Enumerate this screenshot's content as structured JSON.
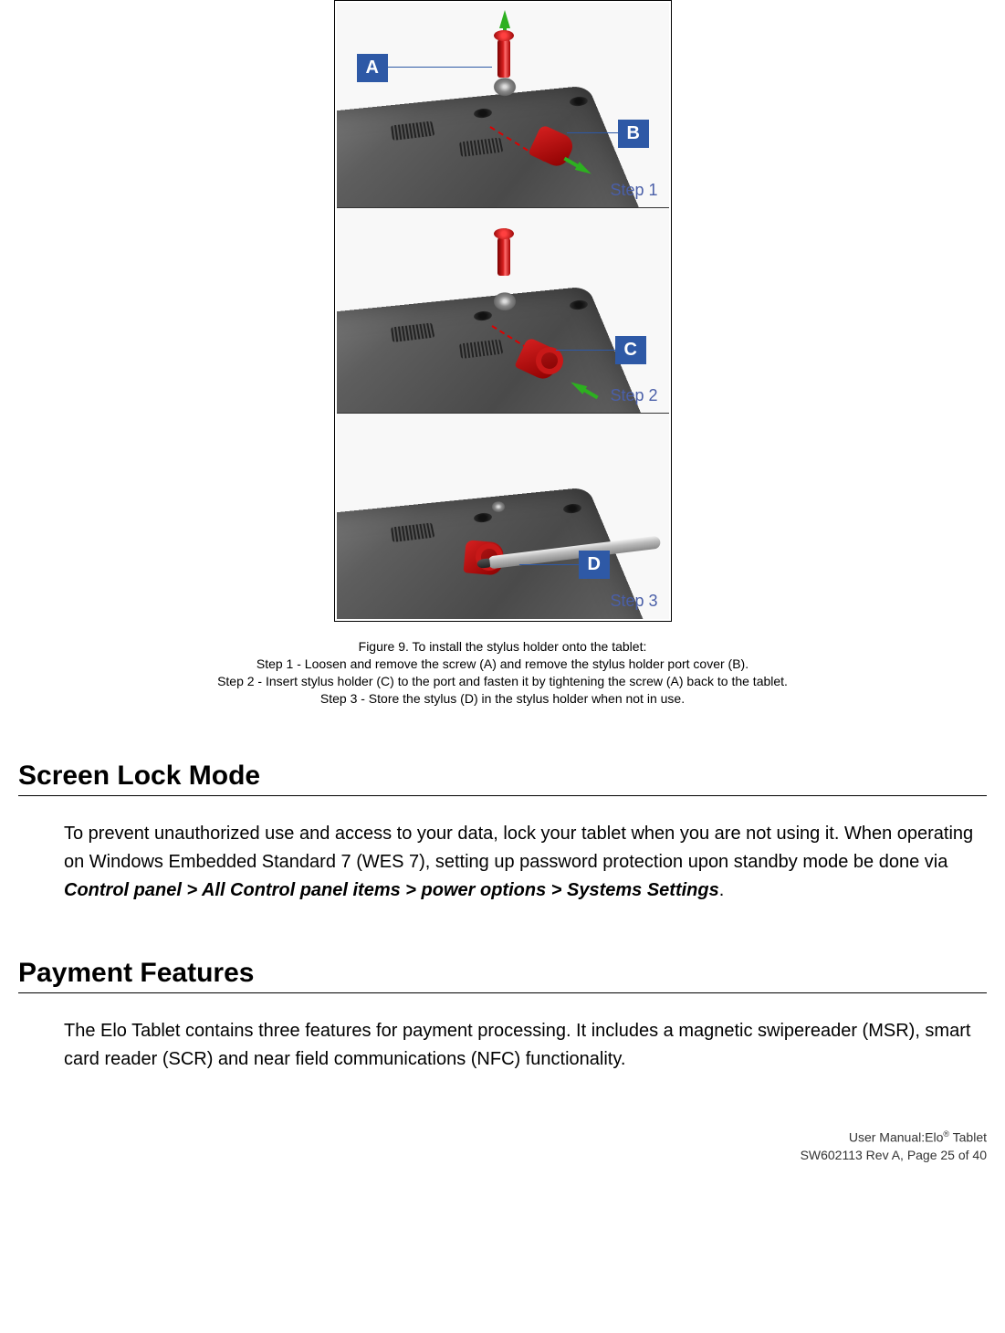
{
  "figure": {
    "labels": {
      "a": "A",
      "b": "B",
      "c": "C",
      "d": "D"
    },
    "steps": {
      "s1": "Step 1",
      "s2": "Step 2",
      "s3": "Step 3"
    },
    "caption_title": "Figure 9. To install the stylus holder onto the tablet:",
    "caption_s1": "Step 1 - Loosen and remove the screw (A) and remove the stylus holder port cover (B).",
    "caption_s2": "Step 2 - Insert stylus holder (C) to the port and fasten it by tightening the screw (A) back to the tablet.",
    "caption_s3": "Step 3 - Store the stylus (D) in the stylus holder when not in use."
  },
  "sections": {
    "screen_lock": {
      "heading": "Screen Lock Mode",
      "para_pre": "To prevent unauthorized use and access to your data, lock your tablet when you are not using it. When operating on Windows Embedded Standard 7 (WES 7), setting up password protection upon standby mode be done via ",
      "para_bold": "Control panel > All Control panel items > power options > Systems Settings",
      "para_post": "."
    },
    "payment": {
      "heading": "Payment Features",
      "para": "The Elo Tablet contains three features for payment processing.   It includes a magnetic swipereader (MSR), smart card reader (SCR) and near field communications (NFC) functionality."
    }
  },
  "footer": {
    "line1_pre": "User Manual:Elo",
    "line1_sup": "®",
    "line1_post": " Tablet",
    "line2": "SW602113 Rev A, Page 25 of 40"
  }
}
